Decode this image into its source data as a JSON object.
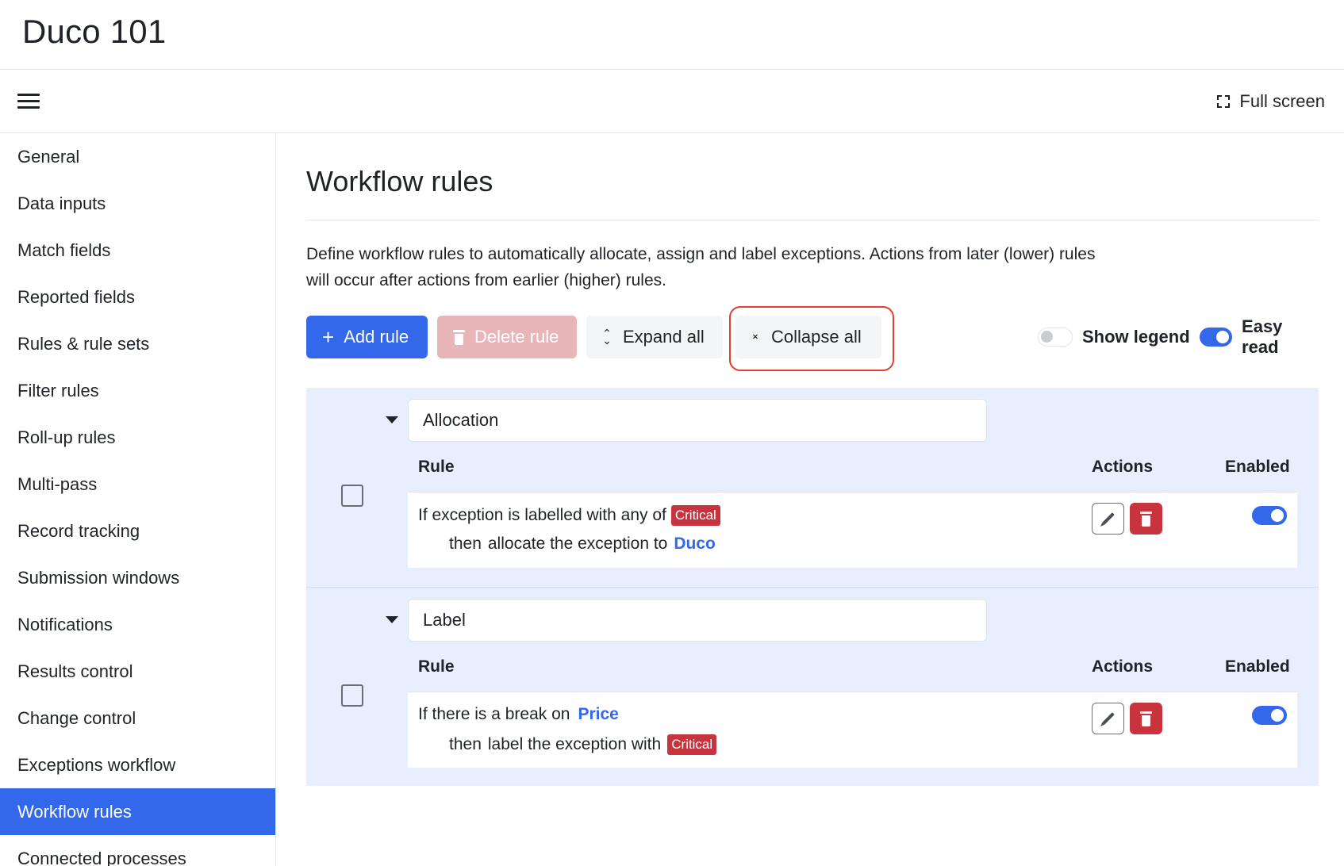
{
  "app": {
    "title": "Duco 101"
  },
  "toolbar": {
    "fullscreen_label": "Full screen",
    "menu_icon": "hamburger-menu-icon",
    "fullscreen_icon": "fullscreen-icon"
  },
  "sidebar": {
    "items": [
      {
        "label": "General",
        "active": false
      },
      {
        "label": "Data inputs",
        "active": false
      },
      {
        "label": "Match fields",
        "active": false
      },
      {
        "label": "Reported fields",
        "active": false
      },
      {
        "label": "Rules & rule sets",
        "active": false
      },
      {
        "label": "Filter rules",
        "active": false
      },
      {
        "label": "Roll-up rules",
        "active": false
      },
      {
        "label": "Multi-pass",
        "active": false
      },
      {
        "label": "Record tracking",
        "active": false
      },
      {
        "label": "Submission windows",
        "active": false
      },
      {
        "label": "Notifications",
        "active": false
      },
      {
        "label": "Results control",
        "active": false
      },
      {
        "label": "Change control",
        "active": false
      },
      {
        "label": "Exceptions workflow",
        "active": false
      },
      {
        "label": "Workflow rules",
        "active": true
      },
      {
        "label": "Connected processes",
        "active": false
      }
    ]
  },
  "main": {
    "title": "Workflow rules",
    "description_line1": "Define workflow rules to automatically allocate, assign and label exceptions. Actions from later (lower) rules",
    "description_line2": "will occur after actions from earlier (higher) rules.",
    "buttons": {
      "add": "Add rule",
      "delete": "Delete rule",
      "expand": "Expand all",
      "collapse": "Collapse all"
    },
    "toggles": {
      "show_legend": {
        "label": "Show legend",
        "on": false
      },
      "easy_read": {
        "label": "Easy read",
        "on": true
      }
    },
    "columns": {
      "rule": "Rule",
      "actions": "Actions",
      "enabled": "Enabled"
    },
    "groups": [
      {
        "name": "Allocation",
        "rule": {
          "line1_text": "If exception is labelled with any of",
          "line1_tag": "Critical",
          "line2_prefix": "then",
          "line2_text": "allocate the exception to",
          "line2_value": "Duco",
          "enabled": true
        }
      },
      {
        "name": "Label",
        "rule": {
          "line1_text": "If there is a break on",
          "line1_value": "Price",
          "line2_prefix": "then",
          "line2_text": "label the exception with",
          "line2_tag": "Critical",
          "enabled": true
        }
      }
    ]
  },
  "colors": {
    "accent": "#3268e9",
    "danger": "#c8343e",
    "group_bg": "#e7efff",
    "highlight_ring": "#e0402c"
  }
}
